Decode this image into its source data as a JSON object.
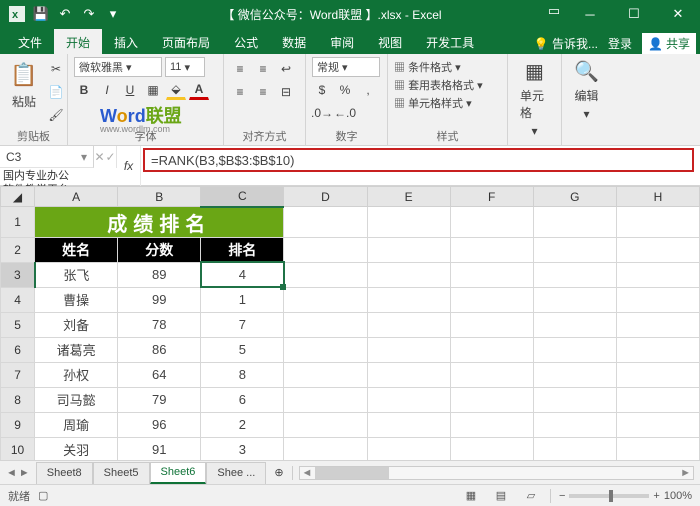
{
  "titlebar": {
    "title": "【 微信公众号：Word联盟 】.xlsx - Excel"
  },
  "tabs": {
    "items": [
      "文件",
      "开始",
      "插入",
      "页面布局",
      "公式",
      "数据",
      "审阅",
      "视图",
      "开发工具"
    ],
    "active": 1,
    "tell": "告诉我...",
    "login": "登录",
    "share": "共享"
  },
  "ribbon": {
    "clipboard": {
      "label": "剪贴板",
      "paste": "粘贴"
    },
    "font": {
      "label": "字体",
      "name": "微软雅黑",
      "size": "11"
    },
    "align": {
      "label": "对齐方式"
    },
    "number": {
      "label": "数字",
      "format": "常规"
    },
    "styles": {
      "label": "样式",
      "cond": "条件格式",
      "tablefmt": "套用表格格式",
      "cellstyle": "单元格样式"
    },
    "cells": {
      "label": "单元格"
    },
    "editing": {
      "label": "编辑"
    },
    "watermark": {
      "word": "Word",
      "lm": "联盟",
      "sub": "www.wordlm.com"
    },
    "teach": "国内专业办公\n软件教学平台"
  },
  "formulaBar": {
    "nameBox": "C3",
    "formula": "=RANK(B3,$B$3:$B$10)"
  },
  "grid": {
    "cols": [
      "A",
      "B",
      "C",
      "D",
      "E",
      "F",
      "G",
      "H"
    ],
    "title": "成绩排名",
    "headers": [
      "姓名",
      "分数",
      "排名"
    ],
    "rows": [
      {
        "n": "3",
        "a": "张飞",
        "b": "89",
        "c": "4",
        "active": true
      },
      {
        "n": "4",
        "a": "曹操",
        "b": "99",
        "c": "1"
      },
      {
        "n": "5",
        "a": "刘备",
        "b": "78",
        "c": "7"
      },
      {
        "n": "6",
        "a": "诸葛亮",
        "b": "86",
        "c": "5"
      },
      {
        "n": "7",
        "a": "孙权",
        "b": "64",
        "c": "8"
      },
      {
        "n": "8",
        "a": "司马懿",
        "b": "79",
        "c": "6"
      },
      {
        "n": "9",
        "a": "周瑜",
        "b": "96",
        "c": "2"
      },
      {
        "n": "10",
        "a": "关羽",
        "b": "91",
        "c": "3"
      }
    ]
  },
  "sheets": {
    "items": [
      "Sheet8",
      "Sheet5",
      "Sheet6",
      "Shee ..."
    ],
    "active": 2
  },
  "status": {
    "ready": "就绪",
    "zoom": "100%",
    "plus": "+"
  }
}
